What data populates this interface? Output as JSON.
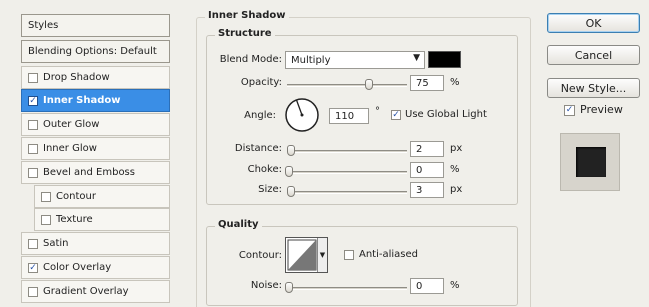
{
  "sidebar": {
    "header": "Styles",
    "blending": "Blending Options: Default",
    "items": [
      {
        "label": "Drop Shadow",
        "checked": false
      },
      {
        "label": "Inner Shadow",
        "checked": true,
        "selected": true
      },
      {
        "label": "Outer Glow",
        "checked": false
      },
      {
        "label": "Inner Glow",
        "checked": false
      },
      {
        "label": "Bevel and Emboss",
        "checked": false
      },
      {
        "label": "Contour",
        "checked": false,
        "sub": true
      },
      {
        "label": "Texture",
        "checked": false,
        "sub": true
      },
      {
        "label": "Satin",
        "checked": false
      },
      {
        "label": "Color Overlay",
        "checked": true
      },
      {
        "label": "Gradient Overlay",
        "checked": false
      }
    ]
  },
  "panel": {
    "title": "Inner Shadow",
    "structure": {
      "title": "Structure",
      "blend_mode_label": "Blend Mode:",
      "blend_mode_value": "Multiply",
      "shadow_color": "#000000",
      "opacity_label": "Opacity:",
      "opacity_value": "75",
      "opacity_unit": "%",
      "opacity_fraction": 0.75,
      "angle_label": "Angle:",
      "angle_value": "110",
      "angle_unit": "°",
      "use_global_light_label": "Use Global Light",
      "use_global_light_checked": true,
      "distance_label": "Distance:",
      "distance_value": "2",
      "distance_unit": "px",
      "choke_label": "Choke:",
      "choke_value": "0",
      "choke_unit": "%",
      "size_label": "Size:",
      "size_value": "3",
      "size_unit": "px"
    },
    "quality": {
      "title": "Quality",
      "contour_label": "Contour:",
      "anti_aliased_label": "Anti-aliased",
      "anti_aliased_checked": false,
      "noise_label": "Noise:",
      "noise_value": "0",
      "noise_unit": "%"
    }
  },
  "buttons": {
    "ok": "OK",
    "cancel": "Cancel",
    "new_style": "New Style...",
    "preview_label": "Preview",
    "preview_checked": true
  }
}
